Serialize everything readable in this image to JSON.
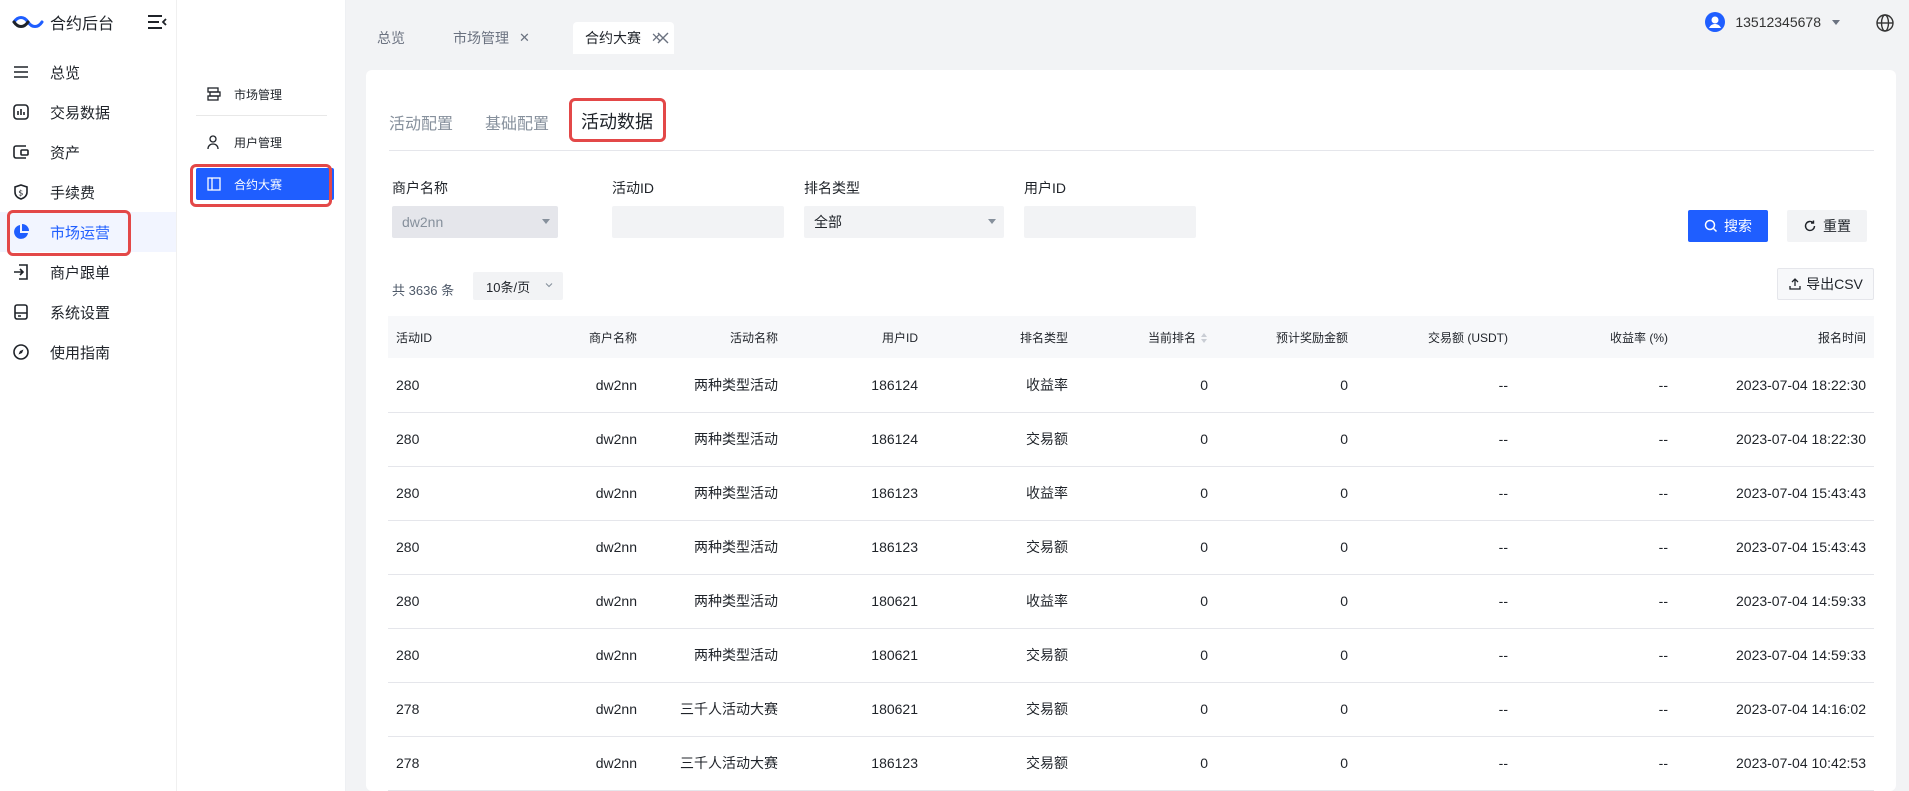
{
  "brand": {
    "title": "合约后台"
  },
  "nav": {
    "items": [
      {
        "label": "总览",
        "icon": "list-icon"
      },
      {
        "label": "交易数据",
        "icon": "bar-chart-icon"
      },
      {
        "label": "资产",
        "icon": "wallet-icon"
      },
      {
        "label": "手续费",
        "icon": "shield-dollar-icon"
      },
      {
        "label": "市场运营",
        "icon": "pie-chart-icon"
      },
      {
        "label": "商户跟单",
        "icon": "exit-icon"
      },
      {
        "label": "系统设置",
        "icon": "server-icon"
      },
      {
        "label": "使用指南",
        "icon": "compass-icon"
      }
    ]
  },
  "subnav": {
    "items": [
      {
        "label": "市场管理"
      },
      {
        "label": "用户管理"
      },
      {
        "label": "合约大赛"
      }
    ]
  },
  "topbar": {
    "tabs": [
      {
        "label": "总览"
      },
      {
        "label": "市场管理"
      },
      {
        "label": "合约大赛"
      }
    ],
    "user": "13512345678"
  },
  "content": {
    "tabs": [
      {
        "label": "活动配置"
      },
      {
        "label": "基础配置"
      },
      {
        "label": "活动数据"
      }
    ]
  },
  "filters": {
    "merchant": {
      "label": "商户名称",
      "value": "dw2nn"
    },
    "activity_id": {
      "label": "活动ID",
      "value": ""
    },
    "rank_type": {
      "label": "排名类型",
      "value": "全部"
    },
    "user_id": {
      "label": "用户ID",
      "value": ""
    },
    "search_label": "搜索",
    "reset_label": "重置"
  },
  "table_meta": {
    "total": "共 3636 条",
    "page_size": "10条/页",
    "export_label": "导出CSV"
  },
  "table": {
    "columns": [
      "活动ID",
      "商户名称",
      "活动名称",
      "用户ID",
      "排名类型",
      "当前排名",
      "预计奖励金额",
      "交易额 (USDT)",
      "收益率 (%)",
      "报名时间"
    ],
    "rows": [
      [
        "280",
        "dw2nn",
        "两种类型活动",
        "186124",
        "收益率",
        "0",
        "0",
        "--",
        "--",
        "2023-07-04 18:22:30"
      ],
      [
        "280",
        "dw2nn",
        "两种类型活动",
        "186124",
        "交易额",
        "0",
        "0",
        "--",
        "--",
        "2023-07-04 18:22:30"
      ],
      [
        "280",
        "dw2nn",
        "两种类型活动",
        "186123",
        "收益率",
        "0",
        "0",
        "--",
        "--",
        "2023-07-04 15:43:43"
      ],
      [
        "280",
        "dw2nn",
        "两种类型活动",
        "186123",
        "交易额",
        "0",
        "0",
        "--",
        "--",
        "2023-07-04 15:43:43"
      ],
      [
        "280",
        "dw2nn",
        "两种类型活动",
        "180621",
        "收益率",
        "0",
        "0",
        "--",
        "--",
        "2023-07-04 14:59:33"
      ],
      [
        "280",
        "dw2nn",
        "两种类型活动",
        "180621",
        "交易额",
        "0",
        "0",
        "--",
        "--",
        "2023-07-04 14:59:33"
      ],
      [
        "278",
        "dw2nn",
        "三千人活动大赛",
        "180621",
        "交易额",
        "0",
        "0",
        "--",
        "--",
        "2023-07-04 14:16:02"
      ],
      [
        "278",
        "dw2nn",
        "三千人活动大赛",
        "186123",
        "交易额",
        "0",
        "0",
        "--",
        "--",
        "2023-07-04 10:42:53"
      ]
    ]
  },
  "colors": {
    "primary": "#1f5eff",
    "highlight": "#e34848"
  }
}
